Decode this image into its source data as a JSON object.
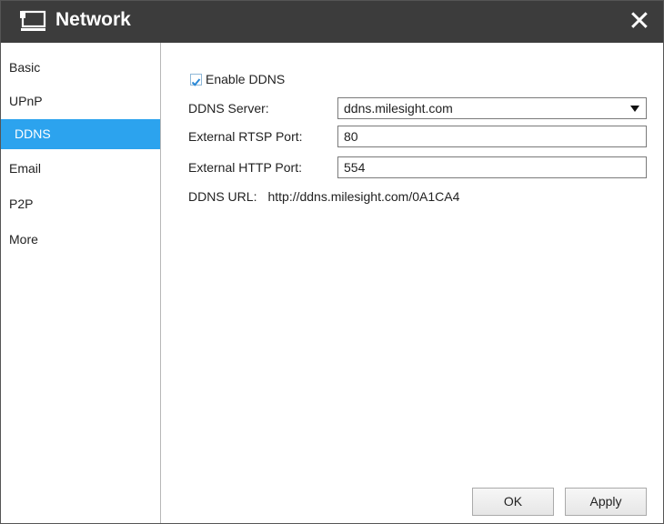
{
  "window": {
    "title": "Network",
    "icon": "network-icon",
    "close_icon": "close-icon",
    "close_glyph": "✕"
  },
  "sidebar": {
    "items": [
      {
        "label": "Basic"
      },
      {
        "label": "UPnP"
      },
      {
        "label": "DDNS",
        "active": true
      },
      {
        "label": "Email"
      },
      {
        "label": "P2P"
      },
      {
        "label": "More"
      }
    ]
  },
  "form": {
    "enable_ddns": {
      "label": "Enable DDNS",
      "checked": true
    },
    "ddns_server": {
      "label": "DDNS Server:",
      "value": "ddns.milesight.com"
    },
    "external_rtsp_port": {
      "label": "External RTSP Port:",
      "value": "80"
    },
    "external_http_port": {
      "label": "External HTTP Port:",
      "value": "554"
    },
    "ddns_url": {
      "label": "DDNS URL:",
      "value": "http://ddns.milesight.com/0A1CA4"
    }
  },
  "buttons": {
    "ok": "OK",
    "apply": "Apply"
  },
  "colors": {
    "titlebar": "#3c3c3c",
    "accent": "#2ca3ee",
    "check": "#2a88d6"
  }
}
